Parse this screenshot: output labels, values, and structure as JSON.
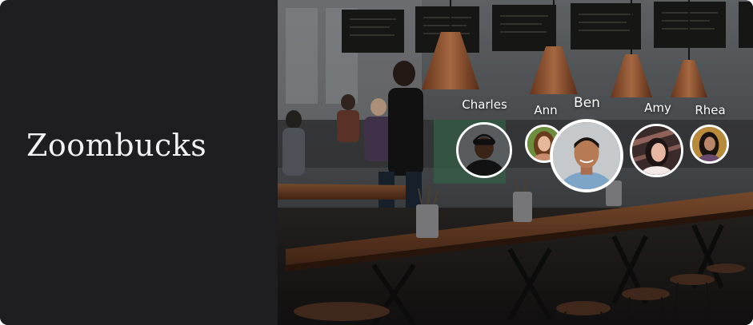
{
  "brand": {
    "title": "Zoombucks"
  },
  "participants": [
    {
      "name": "Charles",
      "icon": "person-avatar"
    },
    {
      "name": "Ann",
      "icon": "person-avatar"
    },
    {
      "name": "Ben",
      "icon": "person-avatar",
      "active": true
    },
    {
      "name": "Amy",
      "icon": "person-avatar"
    },
    {
      "name": "Rhea",
      "icon": "person-avatar"
    }
  ],
  "colors": {
    "panel": "#1e1e20",
    "text": "#f2f2f2",
    "avatar_border": "#ffffff"
  }
}
